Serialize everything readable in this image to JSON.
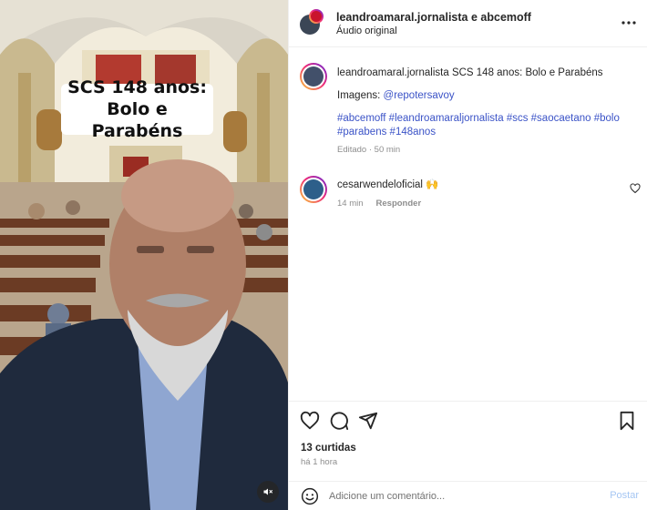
{
  "video": {
    "overlay_line1": "SCS 148 anos:",
    "overlay_line2": "Bolo e Parabéns",
    "mute_icon": "speaker-muted-icon"
  },
  "header": {
    "title": "leandroamaral.jornalista e abcemoff",
    "subtitle": "Áudio original",
    "more_icon": "more-horizontal-icon"
  },
  "caption": {
    "username": "leandroamaral.jornalista",
    "text": "SCS 148 anos: Bolo e Parabéns",
    "credits_label": "Imagens:",
    "credits_link": "@repotersavoy",
    "hashtags_line1": "#abcemoff #leandroamaraljornalista #scs #saocaetano #bolo",
    "hashtags_line2": "#parabens #148anos",
    "edited": "Editado · 50 min"
  },
  "comment": {
    "username": "cesarwendeloficial",
    "text": "🙌",
    "time": "14 min",
    "reply_label": "Responder"
  },
  "actions": {
    "likes": "13 curtidas",
    "time": "há 1 hora"
  },
  "composer": {
    "placeholder": "Adicione um comentário...",
    "post_label": "Postar"
  },
  "colors": {
    "link": "#3b53c7",
    "muted_text": "#8e8e8e",
    "post_disabled": "#a5c6f3"
  }
}
